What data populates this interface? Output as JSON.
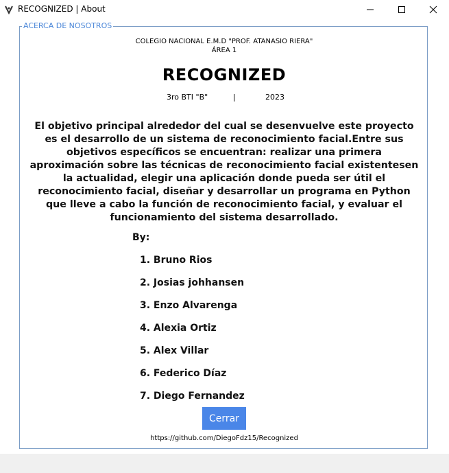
{
  "window": {
    "title": "RECOGNIZED | About",
    "icon": "recognized-app-icon",
    "controls": [
      "minimize-icon",
      "maximize-icon",
      "close-icon"
    ]
  },
  "group": {
    "legend": "ACERCA DE NOSOTROS",
    "border_color": "#7a9cc6",
    "legend_color": "#4a86d8"
  },
  "school": {
    "line1": "COLEGIO NACIONAL E.M.D \"PROF. ATANASIO RIERA\"",
    "line2": "ÁREA 1"
  },
  "app_name": "RECOGNIZED",
  "meta": {
    "class": "3ro BTI \"B\"",
    "separator": "|",
    "year": "2023"
  },
  "description": "El objetivo principal alrededor del cual se desenvuelve este proyecto es el desarrollo de un sistema de reconocimiento facial.Entre sus objetivos específicos se encuentran: realizar una primera aproximación sobre las técnicas de reconocimiento facial existentesen la actualidad, elegir una aplicación donde pueda ser útil el reconocimiento facial, diseñar y desarrollar un programa en Python que lleve a cabo la función de reconocimiento facial, y evaluar el funcionamiento del sistema desarrollado.",
  "by_label": "By:",
  "authors": [
    "1. Bruno Rios",
    "2. Josias johhansen",
    "3. Enzo Alvarenga",
    "4. Alexia Ortiz",
    "5. Alex Villar",
    "6. Federico Díaz",
    "7. Diego Fernandez"
  ],
  "close_button": {
    "label": "Cerrar",
    "color": "#4a86e8"
  },
  "repo_link": "https://github.com/DiegoFdz15/Recognized"
}
